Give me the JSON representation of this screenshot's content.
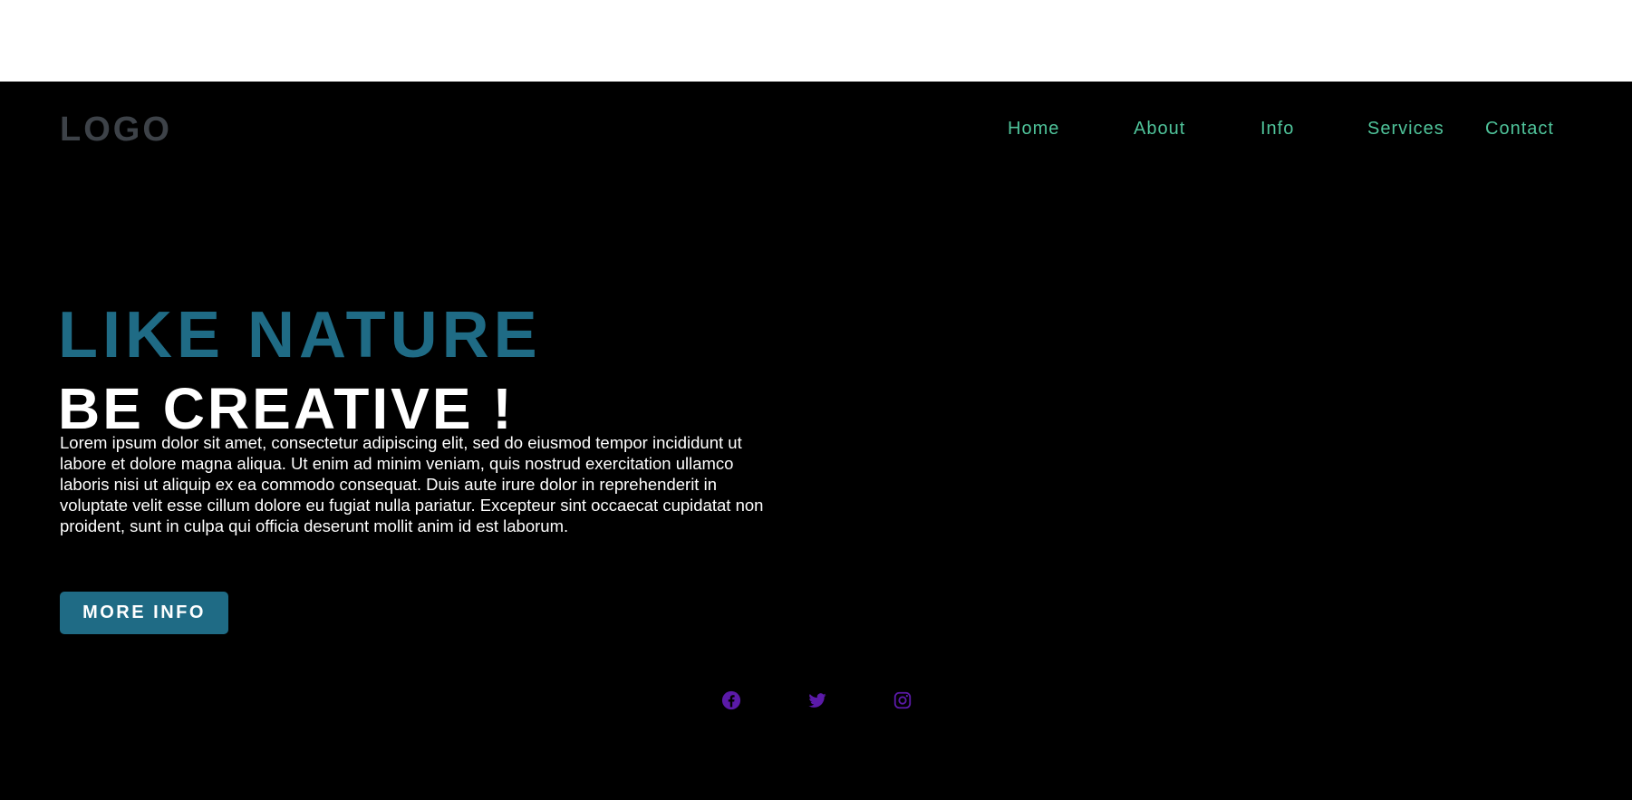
{
  "header": {
    "logo": "LOGO",
    "nav": {
      "home": "Home",
      "about": "About",
      "info": "Info",
      "services": "Services",
      "contact": "Contact"
    }
  },
  "hero": {
    "headline_primary": "LIKE NATURE",
    "headline_secondary": "BE CREATIVE !",
    "body": "Lorem ipsum dolor sit amet, consectetur adipiscing elit, sed do eiusmod tempor incididunt ut labore et dolore magna aliqua. Ut enim ad minim veniam, quis nostrud exercitation ullamco laboris nisi ut aliquip ex ea commodo consequat. Duis aute irure dolor in reprehenderit in voluptate velit esse cillum dolore eu fugiat nulla pariatur. Excepteur sint occaecat cupidatat non proident, sunt in culpa qui officia deserunt mollit anim id est laborum.",
    "button_label": "MORE INFO"
  },
  "social": {
    "icons": [
      "facebook-icon",
      "twitter-icon",
      "instagram-icon"
    ],
    "color": "#5b1aa8"
  },
  "colors": {
    "background": "#000000",
    "accent": "#1f6b85",
    "nav_link": "#4fc39a",
    "logo": "#3d4248"
  }
}
